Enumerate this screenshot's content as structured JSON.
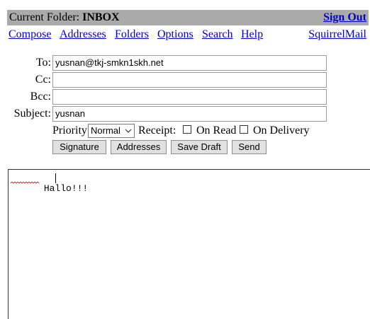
{
  "header": {
    "folder_label": "Current Folder:",
    "folder_name": "INBOX",
    "sign_out": "Sign Out"
  },
  "nav": {
    "items": [
      {
        "label": "Compose"
      },
      {
        "label": "Addresses"
      },
      {
        "label": "Folders"
      },
      {
        "label": "Options"
      },
      {
        "label": "Search"
      },
      {
        "label": "Help"
      }
    ],
    "brand": "SquirrelMail"
  },
  "form": {
    "to_label": "To:",
    "to_value": "yusnan@tkj-smkn1skh.net",
    "cc_label": "Cc:",
    "cc_value": "",
    "bcc_label": "Bcc:",
    "bcc_value": "",
    "subject_label": "Subject:",
    "subject_value": "yusnan",
    "priority_label": "Priority",
    "priority_value": "Normal",
    "receipt_label": "Receipt:",
    "on_read_label": "On Read",
    "on_read_checked": false,
    "on_delivery_label": "On Delivery",
    "on_delivery_checked": false
  },
  "buttons": {
    "signature": "Signature",
    "addresses": "Addresses",
    "save_draft": "Save Draft",
    "send": "Send"
  },
  "message": {
    "body": "Hallo!!!"
  },
  "colors": {
    "topbar_bg": "#aaaaaa",
    "link": "#0000cc",
    "button_bg": "#e1e1e1"
  }
}
